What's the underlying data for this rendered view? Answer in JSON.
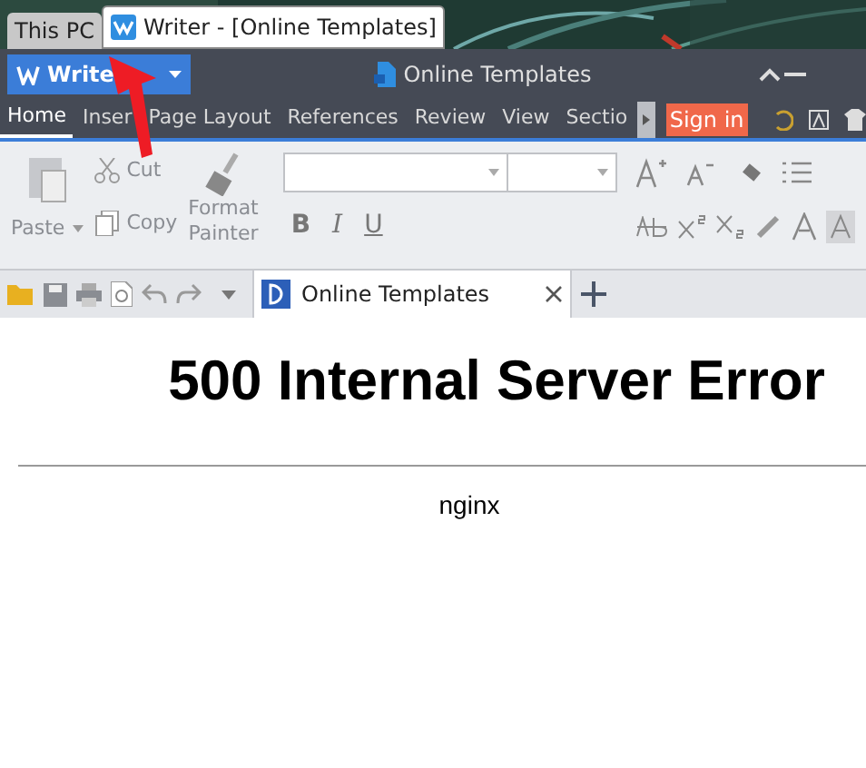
{
  "desktop_tabs": [
    {
      "label": "This PC",
      "selected": false
    },
    {
      "label": "Writer - [Online Templates]",
      "selected": true
    }
  ],
  "app_button": {
    "label": "Write"
  },
  "title": "Online Templates",
  "menu": [
    {
      "label": "Home",
      "selected": true
    },
    {
      "label": "Inser",
      "selected": false
    },
    {
      "label": "Page Layout",
      "selected": false
    },
    {
      "label": "References",
      "selected": false
    },
    {
      "label": "Review",
      "selected": false
    },
    {
      "label": "View",
      "selected": false
    },
    {
      "label": "Sectio",
      "selected": false
    }
  ],
  "sign_in": "Sign in",
  "clipboard": {
    "paste": "Paste",
    "cut": "Cut",
    "copy": "Copy",
    "format_painter": [
      "Format",
      "Painter"
    ]
  },
  "format_buttons": [
    "B",
    "I",
    "U"
  ],
  "doc_tab": {
    "label": "Online Templates"
  },
  "document": {
    "heading": "500 Internal Server Error",
    "server": "nginx"
  }
}
